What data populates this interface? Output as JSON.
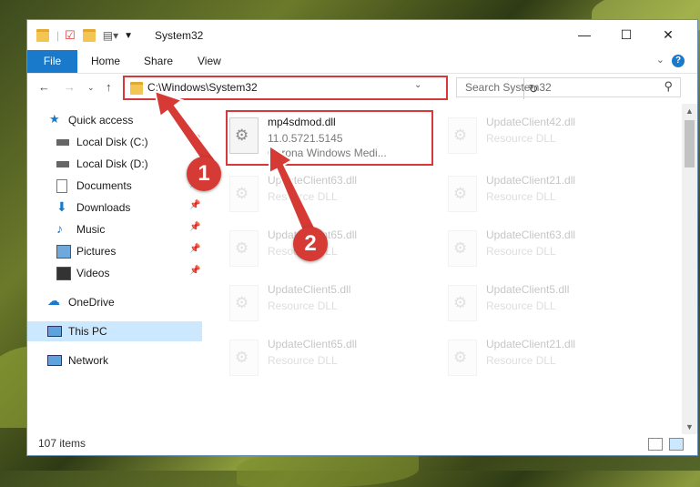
{
  "window": {
    "title": "System32"
  },
  "ribbon": {
    "file": "File",
    "home": "Home",
    "share": "Share",
    "view": "View",
    "help": "?"
  },
  "address": {
    "path": "C:\\Windows\\System32"
  },
  "search": {
    "placeholder": "Search System32"
  },
  "sidebar": {
    "items": [
      {
        "label": "Quick access",
        "icon": "star-icon"
      },
      {
        "label": "Local Disk (C:)",
        "icon": "drive-icon",
        "pinned": true
      },
      {
        "label": "Local Disk (D:)",
        "icon": "drive-icon"
      },
      {
        "label": "Documents",
        "icon": "documents-icon",
        "pinned": true
      },
      {
        "label": "Downloads",
        "icon": "download-icon",
        "pinned": true
      },
      {
        "label": "Music",
        "icon": "music-icon",
        "pinned": true
      },
      {
        "label": "Pictures",
        "icon": "pictures-icon",
        "pinned": true
      },
      {
        "label": "Videos",
        "icon": "videos-icon",
        "pinned": true
      },
      {
        "label": "OneDrive",
        "icon": "cloud-icon"
      },
      {
        "label": "This PC",
        "icon": "computer-icon",
        "selected": true
      },
      {
        "label": "Network",
        "icon": "network-icon"
      }
    ]
  },
  "files": [
    {
      "name": "mp4sdmod.dll",
      "line2": "11.0.5721.5145",
      "line3": "Corona Windows Medi...",
      "highlight": true
    },
    {
      "name": "UpdateClient42.dll",
      "line2": "Resource DLL"
    },
    {
      "name": "UpdateClient63.dll",
      "line2": "Resource DLL"
    },
    {
      "name": "UpdateClient21.dll",
      "line2": "Resource DLL"
    },
    {
      "name": "UpdateClient65.dll",
      "line2": "Resource DLL"
    },
    {
      "name": "UpdateClient63.dll",
      "line2": "Resource DLL"
    },
    {
      "name": "UpdateClient5.dll",
      "line2": "Resource DLL"
    },
    {
      "name": "UpdateClient5.dll",
      "line2": "Resource DLL"
    },
    {
      "name": "UpdateClient65.dll",
      "line2": "Resource DLL"
    },
    {
      "name": "UpdateClient21.dll",
      "line2": "Resource DLL"
    }
  ],
  "status": {
    "count": "107 items"
  },
  "annotations": {
    "step1": "1",
    "step2": "2"
  },
  "colors": {
    "accent": "#1979ca",
    "highlight": "#d9383a",
    "selected": "#cce8ff"
  }
}
